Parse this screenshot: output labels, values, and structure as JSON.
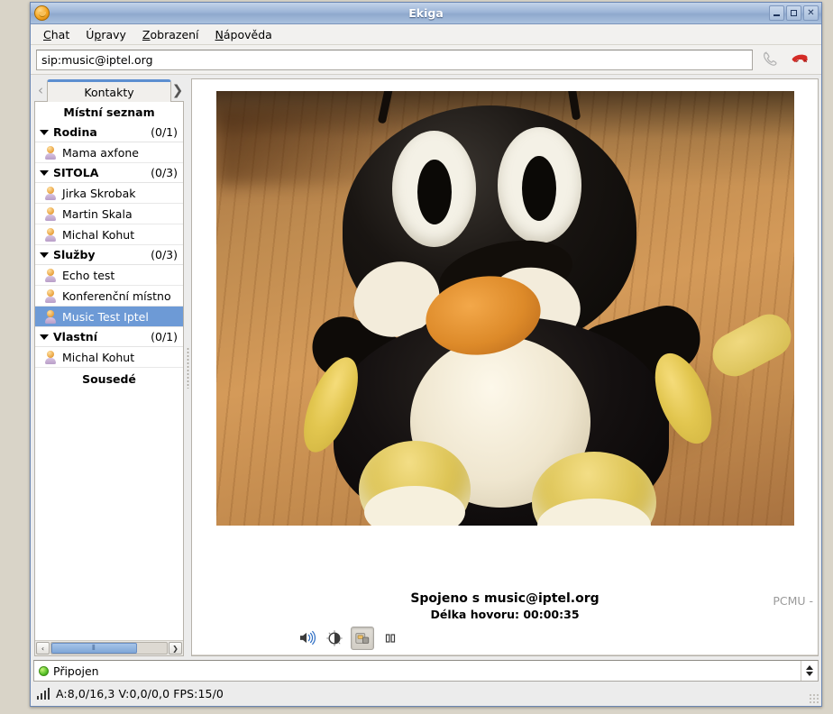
{
  "window": {
    "title": "Ekiga",
    "app_icon": "ekiga-face-icon",
    "buttons": {
      "minimize": "minimize-icon",
      "maximize": "maximize-icon",
      "close": "close-icon"
    }
  },
  "menubar": [
    {
      "label": "Chat",
      "mnemonic": "C"
    },
    {
      "label": "Úpravy",
      "mnemonic": "p"
    },
    {
      "label": "Zobrazení",
      "mnemonic": "Z"
    },
    {
      "label": "Nápověda",
      "mnemonic": "N"
    }
  ],
  "toolbar": {
    "uri_value": "sip:music@iptel.org",
    "uri_placeholder": "sip:",
    "call_icon": "phone-call-icon",
    "hangup_icon": "phone-hangup-icon"
  },
  "sidebar": {
    "tab": {
      "label": "Kontakty",
      "prev_icon": "chevron-left-icon",
      "next_icon": "chevron-right-icon"
    },
    "roster_title": "Místní seznam",
    "footer_title": "Sousedé",
    "groups": [
      {
        "name": "Rodina",
        "count": "(0/1)",
        "expanded": true,
        "contacts": [
          {
            "name": "Mama axfone",
            "selected": false
          }
        ]
      },
      {
        "name": "SITOLA",
        "count": "(0/3)",
        "expanded": true,
        "contacts": [
          {
            "name": "Jirka Skrobak",
            "selected": false
          },
          {
            "name": "Martin Skala",
            "selected": false
          },
          {
            "name": "Michal Kohut",
            "selected": false
          }
        ]
      },
      {
        "name": "Služby",
        "count": "(0/3)",
        "expanded": true,
        "contacts": [
          {
            "name": "Echo test",
            "selected": false
          },
          {
            "name": "Konferenční místno",
            "selected": false
          },
          {
            "name": "Music Test Iptel",
            "selected": true
          }
        ]
      },
      {
        "name": "Vlastní",
        "count": "(0/1)",
        "expanded": true,
        "contacts": [
          {
            "name": "Michal Kohut",
            "selected": false
          }
        ]
      }
    ],
    "scrollbar": {
      "left_icon": "scroll-left-icon",
      "right_icon": "scroll-right-icon",
      "thumb_grip": "⦀"
    }
  },
  "call": {
    "connected_text": "Spojeno s music@iptel.org",
    "duration_text": "Délka hovoru: 00:00:35",
    "codec_text": "PCMU -",
    "video_alt": "remote-video-plush-mole-on-wooden-floor",
    "controls": [
      {
        "name": "audio-volume-icon",
        "pressed": false
      },
      {
        "name": "brightness-contrast-icon",
        "pressed": false
      },
      {
        "name": "video-settings-icon",
        "pressed": true
      },
      {
        "name": "pause-call-icon",
        "pressed": false
      }
    ]
  },
  "statusbar": {
    "presence_label": "Připojen",
    "presence_color": "#5ac22a",
    "dropdown_icon": "combo-arrows-icon",
    "stats_icon": "signal-bars-icon",
    "stats_text": "A:8,0/16,3  V:0,0/0,0  FPS:15/0"
  }
}
